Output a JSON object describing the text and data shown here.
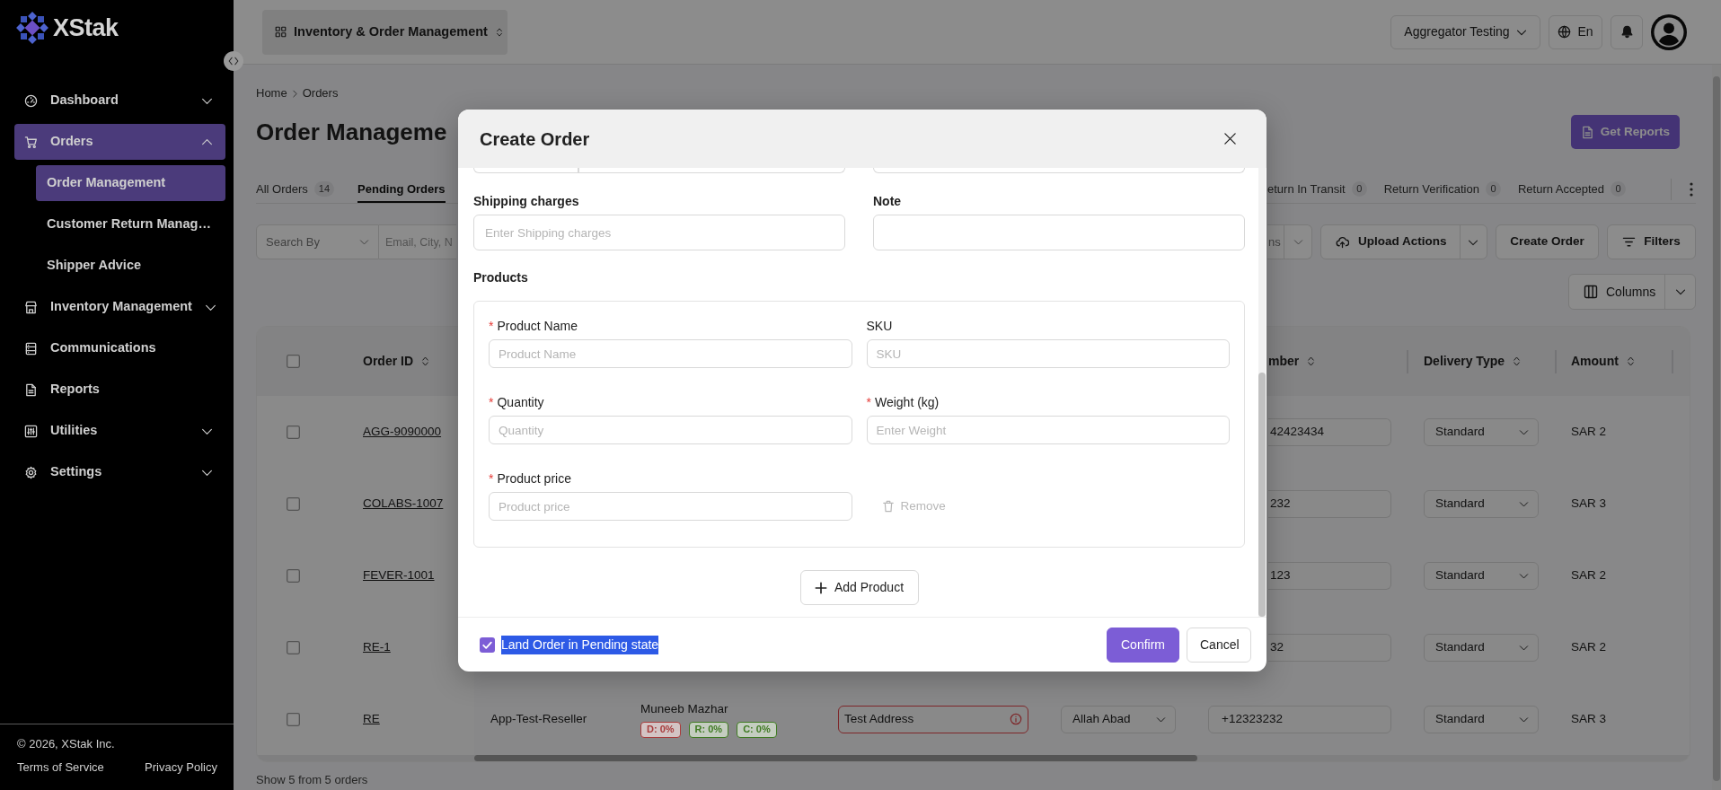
{
  "sidebar": {
    "brand": "XStak",
    "items": [
      {
        "label": "Dashboard",
        "kind": "group",
        "expanded": false,
        "selected": false
      },
      {
        "label": "Orders",
        "kind": "group",
        "expanded": true,
        "selected": true,
        "children": [
          {
            "label": "Order Management",
            "selected": true
          },
          {
            "label": "Customer Return Manag…",
            "selected": false
          },
          {
            "label": "Shipper Advice",
            "selected": false
          }
        ]
      },
      {
        "label": "Inventory Management",
        "kind": "group",
        "expanded": false,
        "selected": false
      },
      {
        "label": "Communications",
        "kind": "link",
        "selected": false
      },
      {
        "label": "Reports",
        "kind": "link",
        "selected": false
      },
      {
        "label": "Utilities",
        "kind": "group",
        "expanded": false,
        "selected": false
      },
      {
        "label": "Settings",
        "kind": "group",
        "expanded": false,
        "selected": false
      }
    ],
    "footer": {
      "copyright": "© 2026, XStak Inc.",
      "links": [
        "Terms of Service",
        "Privacy Policy"
      ]
    }
  },
  "topbar": {
    "app_switcher": "Inventory & Order Management",
    "account": "Aggregator Testing",
    "language": "En"
  },
  "breadcrumb": [
    "Home",
    "Orders"
  ],
  "page_title": "Order Manageme",
  "get_reports": "Get Reports",
  "tabs_left": [
    {
      "label": "All Orders",
      "count": "14",
      "selected": false
    },
    {
      "label": "Pending Orders",
      "selected": true
    }
  ],
  "tabs_right": [
    {
      "label": "eturn In Transit",
      "count": "0",
      "selected": false
    },
    {
      "label": "Return Verification",
      "count": "0",
      "selected": false
    },
    {
      "label": "Return Accepted",
      "count": "0",
      "selected": false
    }
  ],
  "toolbar": {
    "search_by": "Search By",
    "search_placeholder": "Email, City, N",
    "select_fragment": "ns",
    "upload_actions": "Upload Actions",
    "create_order": "Create Order",
    "filters": "Filters",
    "columns": "Columns"
  },
  "table": {
    "select_all_checked": false,
    "columns_left": [
      {
        "label": "Order ID"
      }
    ],
    "columns_right": [
      {
        "label": "mber"
      },
      {
        "label": "Delivery Type"
      },
      {
        "label": "Amount"
      }
    ],
    "rows": [
      {
        "kind": "covered",
        "checked": false,
        "order_id": "AGG-9090000",
        "phone": "42423434",
        "delivery_type": "Standard",
        "amount": "SAR 2"
      },
      {
        "kind": "covered",
        "checked": false,
        "order_id": "COLABS-1007",
        "phone": "232",
        "delivery_type": "Standard",
        "amount": "SAR 3"
      },
      {
        "kind": "covered",
        "checked": false,
        "order_id": "FEVER-1001",
        "phone": "123",
        "delivery_type": "Standard",
        "amount": "SAR 2"
      },
      {
        "kind": "covered",
        "checked": false,
        "order_id": "RE-1",
        "phone": "32",
        "delivery_type": "Standard",
        "amount": "SAR 2"
      },
      {
        "kind": "full",
        "checked": false,
        "order_id": "RE",
        "channel": "App-Test-Reseller",
        "customer": {
          "name": "Muneeb Mazhar",
          "tags": [
            {
              "text": "D: 0%",
              "color": "#a83c3c"
            },
            {
              "text": "R: 0%",
              "color": "#3f7a22"
            },
            {
              "text": "C: 0%",
              "color": "#3f7a22"
            }
          ]
        },
        "address": {
          "value": "Test Address",
          "invalid": true
        },
        "city": "Allah Abad",
        "phone": "+12323232",
        "delivery_type": "Standard",
        "amount": "SAR 3"
      }
    ],
    "footer": "Show 5 from 5 orders"
  },
  "dialog": {
    "title": "Create Order",
    "fields": [
      {
        "label": "Shipping charges",
        "placeholder": "Enter Shipping charges"
      },
      {
        "label": "Note"
      }
    ],
    "products_label": "Products",
    "required_mark": "*",
    "products": [
      {
        "fields": [
          {
            "label": "Product Name",
            "required": true,
            "placeholder": "Product Name"
          },
          {
            "label": "SKU",
            "required": false,
            "placeholder": "SKU"
          },
          {
            "label": "Quantity",
            "required": true,
            "placeholder": "Quantity"
          },
          {
            "label": "Weight (kg)",
            "required": true,
            "placeholder": "Enter Weight"
          },
          {
            "label": "Product price",
            "required": true,
            "placeholder": "Product price"
          }
        ],
        "remove": {
          "label": "Remove",
          "disabled": true
        }
      }
    ],
    "add_product": "Add Product",
    "pending_option": {
      "label": "Land Order in Pending state",
      "checked": true,
      "text_selected": true
    },
    "buttons": [
      {
        "label": "Confirm",
        "kind": "primary"
      },
      {
        "label": "Cancel",
        "kind": "secondary"
      }
    ]
  }
}
